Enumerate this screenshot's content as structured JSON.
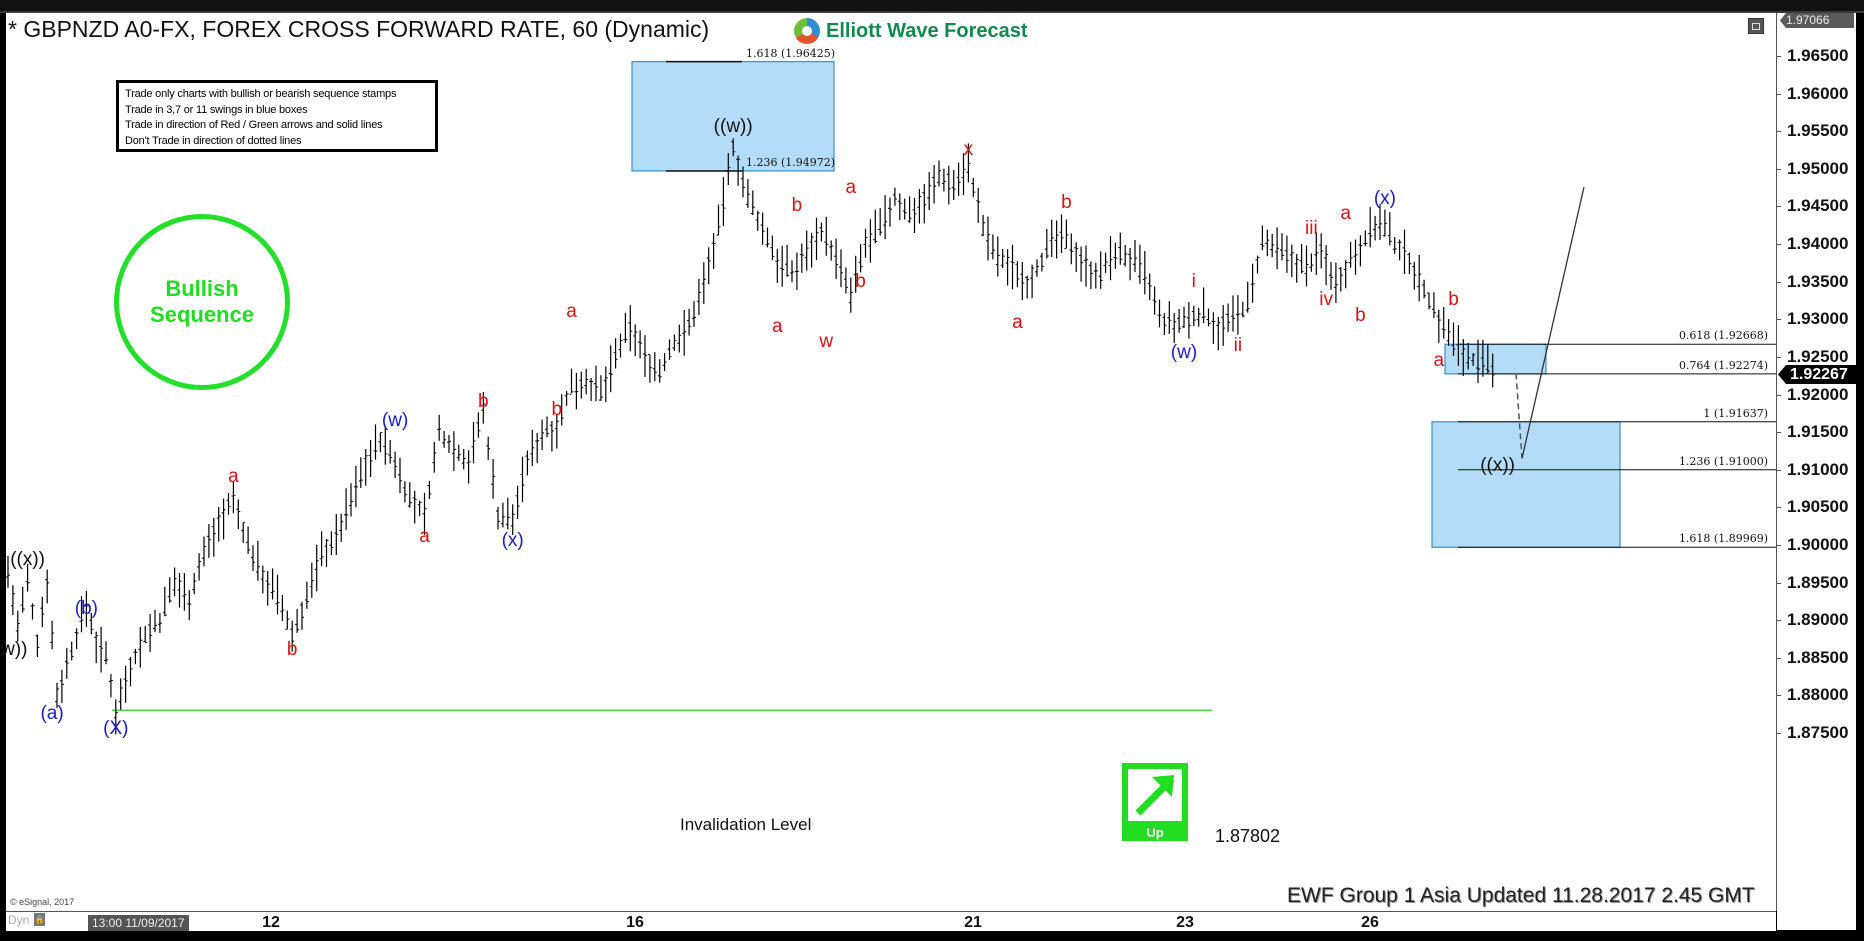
{
  "header": {
    "title": "* GBPNZD A0-FX, FOREX CROSS FORWARD RATE, 60 (Dynamic)",
    "brand": "Elliott Wave Forecast"
  },
  "rules_box": {
    "lines": [
      "Trade only charts with bullish or bearish sequence stamps",
      "Trade in 3,7 or 11 swings in blue boxes",
      "Trade in direction of Red / Green arrows and solid lines",
      "Don't Trade in direction of dotted lines"
    ]
  },
  "stamp": {
    "line1": "Bullish",
    "line2": "Sequence",
    "color": "#22e02a"
  },
  "footer": {
    "copyright": "© eSignal, 2017",
    "updated": "EWF Group 1 Asia Updated 11.28.2017 2.45 GMT",
    "dyn": "Dyn",
    "start_time": "13:00 11/09/2017"
  },
  "invalidation": {
    "label": "Invalidation Level",
    "value": "1.87802",
    "price": 1.87802
  },
  "direction_badge": {
    "label": "Up",
    "icon": "arrow-up-right-icon"
  },
  "price_axis": {
    "top_value": "1.97066",
    "current_value": "1.92267",
    "ticks": [
      "1.96500",
      "1.96000",
      "1.95500",
      "1.95000",
      "1.94500",
      "1.94000",
      "1.93500",
      "1.93000",
      "1.92500",
      "1.92000",
      "1.91500",
      "1.91000",
      "1.90500",
      "1.90000",
      "1.89500",
      "1.89000",
      "1.88500",
      "1.88000",
      "1.87500"
    ]
  },
  "chart_data": {
    "type": "ohlc-bar",
    "title": "* GBPNZD A0-FX, FOREX CROSS FORWARD RATE, 60 (Dynamic)",
    "xlabel": "",
    "ylabel": "",
    "ylim": [
      1.8712,
      1.9707
    ],
    "x_ticks": [
      "13:00 11/09/2017",
      "12",
      "16",
      "21",
      "23",
      "26"
    ],
    "current_price": 1.92267,
    "price_path": [
      [
        0,
        1.8965
      ],
      [
        2,
        1.889
      ],
      [
        4,
        1.895
      ],
      [
        6,
        1.887
      ],
      [
        8,
        1.8955
      ],
      [
        10,
        1.88
      ],
      [
        12,
        1.884
      ],
      [
        14,
        1.888
      ],
      [
        16,
        1.892
      ],
      [
        18,
        1.887
      ],
      [
        20,
        1.885
      ],
      [
        22,
        1.878
      ],
      [
        25,
        1.884
      ],
      [
        28,
        1.888
      ],
      [
        31,
        1.89
      ],
      [
        34,
        1.895
      ],
      [
        37,
        1.893
      ],
      [
        40,
        1.899
      ],
      [
        43,
        1.903
      ],
      [
        46,
        1.906
      ],
      [
        49,
        1.9
      ],
      [
        52,
        1.896
      ],
      [
        55,
        1.893
      ],
      [
        58,
        1.888
      ],
      [
        61,
        1.893
      ],
      [
        64,
        1.899
      ],
      [
        67,
        1.901
      ],
      [
        70,
        1.906
      ],
      [
        73,
        1.911
      ],
      [
        76,
        1.914
      ],
      [
        79,
        1.911
      ],
      [
        82,
        1.906
      ],
      [
        85,
        1.904
      ],
      [
        88,
        1.915
      ],
      [
        91,
        1.913
      ],
      [
        94,
        1.911
      ],
      [
        97,
        1.918
      ],
      [
        100,
        1.904
      ],
      [
        103,
        1.9035
      ],
      [
        106,
        1.911
      ],
      [
        109,
        1.915
      ],
      [
        112,
        1.916
      ],
      [
        115,
        1.921
      ],
      [
        118,
        1.922
      ],
      [
        121,
        1.92
      ],
      [
        124,
        1.925
      ],
      [
        127,
        1.929
      ],
      [
        130,
        1.925
      ],
      [
        133,
        1.923
      ],
      [
        136,
        1.927
      ],
      [
        139,
        1.929
      ],
      [
        142,
        1.935
      ],
      [
        145,
        1.942
      ],
      [
        148,
        1.953
      ],
      [
        151,
        1.946
      ],
      [
        154,
        1.942
      ],
      [
        157,
        1.938
      ],
      [
        160,
        1.936
      ],
      [
        163,
        1.939
      ],
      [
        166,
        1.942
      ],
      [
        169,
        1.938
      ],
      [
        172,
        1.933
      ],
      [
        175,
        1.94
      ],
      [
        178,
        1.942
      ],
      [
        181,
        1.946
      ],
      [
        184,
        1.944
      ],
      [
        187,
        1.946
      ],
      [
        190,
        1.949
      ],
      [
        193,
        1.948
      ],
      [
        196,
        1.9505
      ],
      [
        199,
        1.942
      ],
      [
        202,
        1.938
      ],
      [
        205,
        1.937
      ],
      [
        208,
        1.935
      ],
      [
        211,
        1.938
      ],
      [
        214,
        1.941
      ],
      [
        217,
        1.94
      ],
      [
        220,
        1.937
      ],
      [
        223,
        1.936
      ],
      [
        226,
        1.939
      ],
      [
        229,
        1.938
      ],
      [
        232,
        1.936
      ],
      [
        235,
        1.93
      ],
      [
        238,
        1.929
      ],
      [
        241,
        1.93
      ],
      [
        244,
        1.931
      ],
      [
        247,
        1.929
      ],
      [
        250,
        1.93
      ],
      [
        253,
        1.932
      ],
      [
        256,
        1.94
      ],
      [
        259,
        1.939
      ],
      [
        262,
        1.938
      ],
      [
        265,
        1.937
      ],
      [
        268,
        1.939
      ],
      [
        271,
        1.935
      ],
      [
        274,
        1.938
      ],
      [
        277,
        1.941
      ],
      [
        280,
        1.943
      ],
      [
        283,
        1.94
      ],
      [
        286,
        1.938
      ],
      [
        289,
        1.934
      ],
      [
        292,
        1.93
      ],
      [
        295,
        1.927
      ],
      [
        298,
        1.925
      ],
      [
        301,
        1.924
      ],
      [
        304,
        1.9225
      ]
    ],
    "wave_labels": [
      {
        "text": "((w))",
        "color": "black",
        "price": 1.886,
        "bar": 0
      },
      {
        "text": "((x))",
        "color": "black",
        "price": 1.898,
        "bar": 4
      },
      {
        "text": "(a)",
        "color": "blue",
        "price": 1.8775,
        "bar": 9
      },
      {
        "text": "(b)",
        "color": "blue",
        "price": 1.8915,
        "bar": 16
      },
      {
        "text": "(X)",
        "color": "blue",
        "price": 1.8755,
        "bar": 22
      },
      {
        "text": "a",
        "color": "red",
        "price": 1.909,
        "bar": 46
      },
      {
        "text": "b",
        "color": "red",
        "price": 1.886,
        "bar": 58
      },
      {
        "text": "(w)",
        "color": "blue",
        "price": 1.9165,
        "bar": 79
      },
      {
        "text": "a",
        "color": "red",
        "price": 1.901,
        "bar": 85
      },
      {
        "text": "b",
        "color": "red",
        "price": 1.919,
        "bar": 97
      },
      {
        "text": "(x)",
        "color": "blue",
        "price": 1.9005,
        "bar": 103
      },
      {
        "text": "b",
        "color": "red",
        "price": 1.918,
        "bar": 112
      },
      {
        "text": "a",
        "color": "red",
        "price": 1.931,
        "bar": 115
      },
      {
        "text": "((w))",
        "color": "black",
        "price": 1.9555,
        "bar": 148
      },
      {
        "text": "a",
        "color": "red",
        "price": 1.929,
        "bar": 157
      },
      {
        "text": "b",
        "color": "red",
        "price": 1.945,
        "bar": 161
      },
      {
        "text": "w",
        "color": "red",
        "price": 1.927,
        "bar": 167
      },
      {
        "text": "a",
        "color": "red",
        "price": 1.9475,
        "bar": 172
      },
      {
        "text": "b",
        "color": "red",
        "price": 1.935,
        "bar": 174
      },
      {
        "text": "x",
        "color": "red",
        "price": 1.9525,
        "bar": 196
      },
      {
        "text": "b",
        "color": "red",
        "price": 1.9455,
        "bar": 216
      },
      {
        "text": "a",
        "color": "red",
        "price": 1.9295,
        "bar": 206
      },
      {
        "text": "i",
        "color": "red",
        "price": 1.935,
        "bar": 242
      },
      {
        "text": "(w)",
        "color": "blue",
        "price": 1.9255,
        "bar": 240
      },
      {
        "text": "ii",
        "color": "red",
        "price": 1.9265,
        "bar": 251
      },
      {
        "text": "iii",
        "color": "red",
        "price": 1.942,
        "bar": 266
      },
      {
        "text": "iv",
        "color": "red",
        "price": 1.9325,
        "bar": 269
      },
      {
        "text": "a",
        "color": "red",
        "price": 1.944,
        "bar": 273
      },
      {
        "text": "b",
        "color": "red",
        "price": 1.9305,
        "bar": 276
      },
      {
        "text": "(x)",
        "color": "blue",
        "price": 1.946,
        "bar": 281
      },
      {
        "text": "b",
        "color": "red",
        "price": 1.9325,
        "bar": 295
      },
      {
        "text": "a",
        "color": "red",
        "price": 1.9245,
        "bar": 292
      },
      {
        "text": "((x))",
        "color": "black",
        "price": 1.9105,
        "bar": 304
      }
    ],
    "fib_levels_upper": [
      {
        "label": "1.618 (1.96425)",
        "price": 1.96425
      },
      {
        "label": "1.236 (1.94972)",
        "price": 1.94972
      }
    ],
    "fib_levels_lower": [
      {
        "label": "0.618 (1.92668)",
        "price": 1.92668
      },
      {
        "label": "0.764 (1.92274)",
        "price": 1.92274
      },
      {
        "label": "1 (1.91637)",
        "price": 1.91637
      },
      {
        "label": "1.236 (1.91000)",
        "price": 1.91
      },
      {
        "label": "1.618 (1.89969)",
        "price": 1.89969
      }
    ],
    "blue_boxes": [
      {
        "top": 1.96425,
        "bottom": 1.94972
      },
      {
        "top": 1.92668,
        "bottom": 1.92274
      },
      {
        "top": 1.91637,
        "bottom": 1.89969
      }
    ],
    "projection": {
      "from": 1.9228,
      "to_low": 1.9115,
      "to_high": 1.9512
    },
    "invalidation_level": 1.87802
  }
}
